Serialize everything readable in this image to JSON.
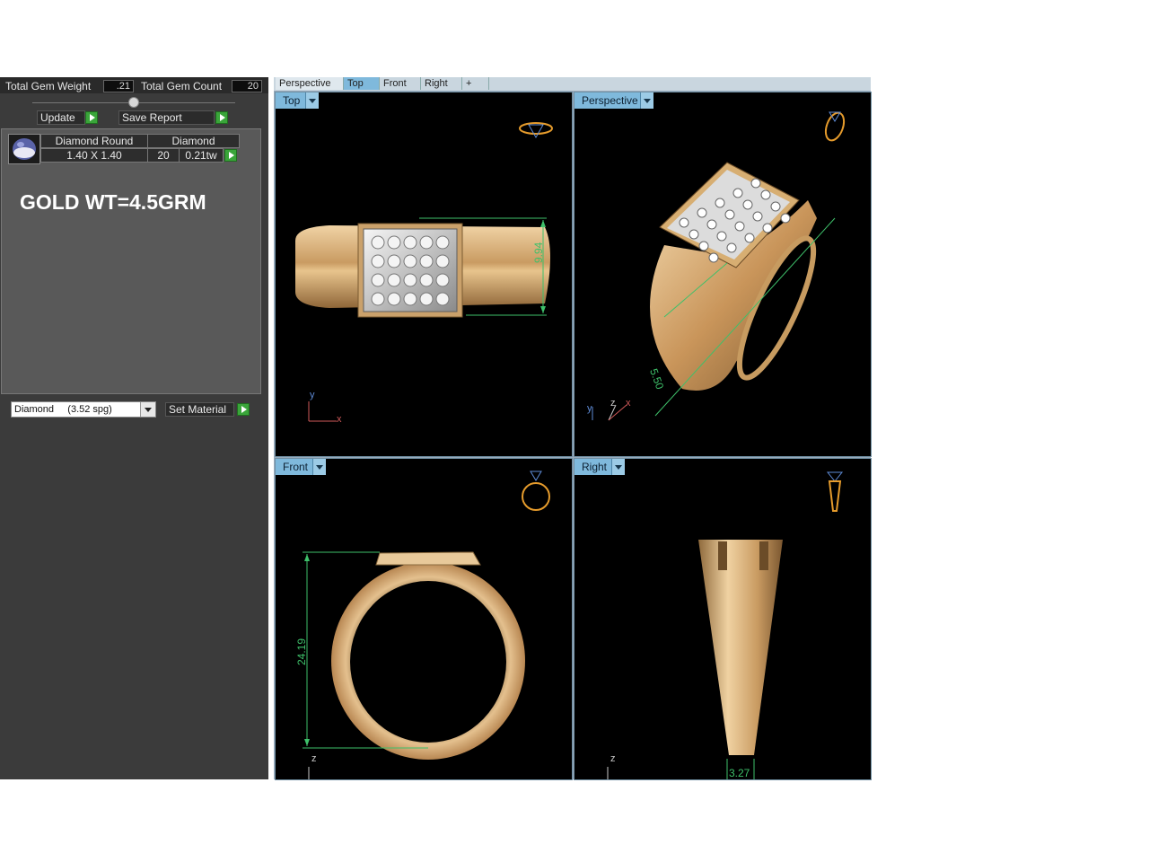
{
  "left_panel": {
    "total_gem_weight_label": "Total Gem Weight",
    "total_gem_weight_value": ".21",
    "total_gem_count_label": "Total Gem Count",
    "total_gem_count_value": "20",
    "update_label": "Update",
    "save_report_label": "Save Report",
    "gem": {
      "shape": "Diamond Round",
      "type": "Diamond",
      "size": "1.40 X 1.40",
      "count": "20",
      "weight": "0.21tw"
    },
    "note": "GOLD WT=4.5GRM",
    "material_select": "Diamond     (3.52 spg)",
    "set_material_label": "Set Material"
  },
  "tabs": [
    "Perspective",
    "Top",
    "Front",
    "Right",
    "+"
  ],
  "viewports": {
    "top": {
      "label": "Top",
      "dimension": "9.94",
      "axis_y": "y",
      "axis_x": "x"
    },
    "perspective": {
      "label": "Perspective",
      "dimension": "5.50",
      "axis_y": "y",
      "axis_z": "z",
      "axis_x": "x"
    },
    "front": {
      "label": "Front",
      "dimension": "24.19",
      "axis_z": "z"
    },
    "right": {
      "label": "Right",
      "dimension": "3.27",
      "axis_z": "z"
    }
  },
  "colors": {
    "panel_bg": "#3b3b3b",
    "viewport_bg": "#000000",
    "gold": "#d9b07a",
    "dimension_green": "#3ec06a",
    "viewport_tab": "#7fb9dc"
  }
}
